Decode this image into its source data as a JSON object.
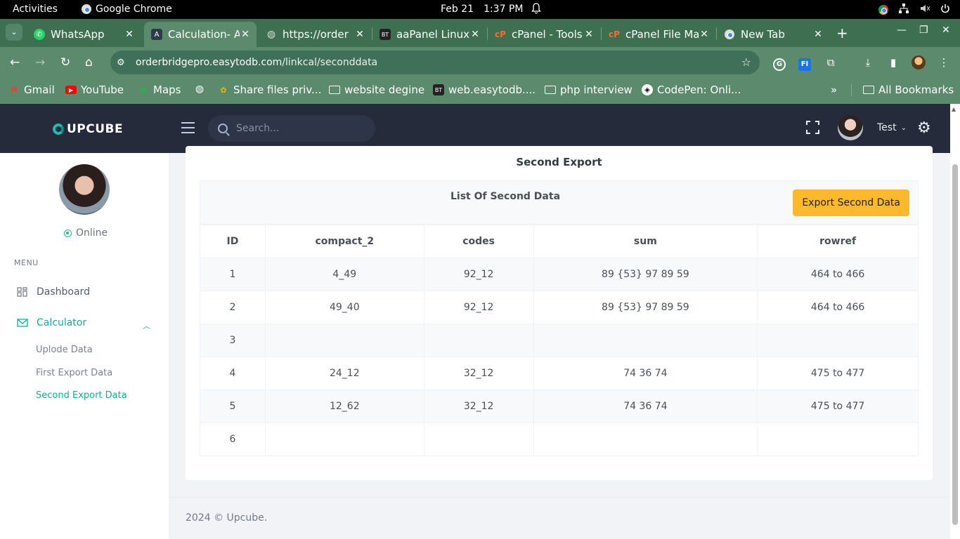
{
  "system_bar": {
    "activities": "Activities",
    "app_name": "Google Chrome",
    "date": "Feb 21",
    "time": "1:37 PM"
  },
  "browser": {
    "tabs": [
      {
        "title": "WhatsApp",
        "icon": "whatsapp-icon",
        "active": false
      },
      {
        "title": "Calculation- A",
        "icon": "app-a-icon",
        "active": true
      },
      {
        "title": "https://order",
        "icon": "globe-icon",
        "active": false
      },
      {
        "title": "aaPanel Linux",
        "icon": "bt-icon",
        "active": false
      },
      {
        "title": "cPanel - Tools",
        "icon": "cpanel-icon",
        "active": false
      },
      {
        "title": "cPanel File Ma",
        "icon": "cpanel-icon",
        "active": false
      },
      {
        "title": "New Tab",
        "icon": "chrome-icon",
        "active": false
      }
    ],
    "url_host": "orderbridgepro.easytodb.com",
    "url_path": "/linkcal/seconddata",
    "bookmarks": [
      {
        "label": "Gmail",
        "icon": "gmail-icon"
      },
      {
        "label": "YouTube",
        "icon": "youtube-icon"
      },
      {
        "label": "Maps",
        "icon": "maps-icon"
      },
      {
        "label": "",
        "icon": "globe-icon"
      },
      {
        "label": "Share files priv...",
        "icon": "share-icon"
      },
      {
        "label": "website degine",
        "icon": "folder-icon"
      },
      {
        "label": "web.easytodb....",
        "icon": "bt-icon"
      },
      {
        "label": "php interview",
        "icon": "folder-icon"
      },
      {
        "label": "CodePen: Onli...",
        "icon": "codepen-icon"
      }
    ],
    "all_bookmarks": "All Bookmarks"
  },
  "header": {
    "logo": "UPCUBE",
    "search_placeholder": "Search...",
    "user_name": "Test"
  },
  "sidebar": {
    "status": "Online",
    "menu_title": "MENU",
    "items": [
      {
        "label": "Dashboard"
      },
      {
        "label": "Calculator"
      }
    ],
    "sub_items": [
      {
        "label": "Uplode Data",
        "active": false
      },
      {
        "label": "First Export Data",
        "active": false
      },
      {
        "label": "Second Export Data",
        "active": true
      }
    ]
  },
  "main": {
    "card_title": "Second Export",
    "list_title": "List Of Second Data",
    "export_button": "Export Second Data",
    "columns": [
      "ID",
      "compact_2",
      "codes",
      "sum",
      "rowref"
    ],
    "rows": [
      [
        "1",
        "4_49",
        "92_12",
        "89 {53} 97 89 59",
        "464 to 466"
      ],
      [
        "2",
        "49_40",
        "92_12",
        "89 {53} 97 89 59",
        "464 to 466"
      ],
      [
        "3",
        "",
        "",
        "",
        ""
      ],
      [
        "4",
        "24_12",
        "32_12",
        "74 36 74",
        "475 to 477"
      ],
      [
        "5",
        "12_62",
        "32_12",
        "74 36 74",
        "475 to 477"
      ],
      [
        "6",
        "",
        "",
        "",
        ""
      ]
    ]
  },
  "footer": {
    "text": "2024 © Upcube."
  },
  "colors": {
    "accent": "#0bb197",
    "export_button": "#fcb92c",
    "header_bg": "#252b3b",
    "browser_frame": "#5b8a6d"
  }
}
